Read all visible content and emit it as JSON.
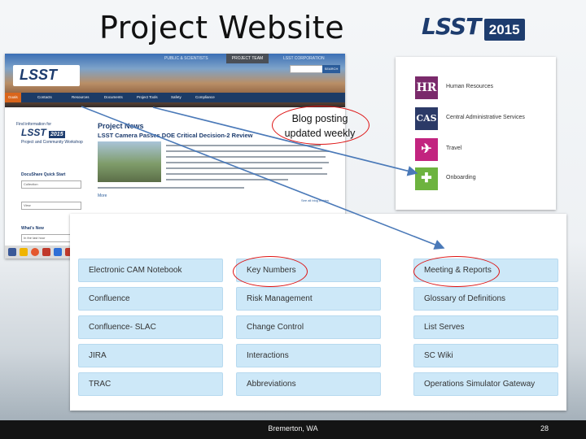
{
  "slide": {
    "title": "Project Website",
    "logo_text": "LSST",
    "logo_year": "2015",
    "footer_location": "Bremerton, WA",
    "page_number": "28",
    "callout": {
      "line1": "Blog posting",
      "line2": "updated weekly"
    }
  },
  "website": {
    "top_links": [
      "PUBLIC & SCIENTISTS",
      "PROJECT TEAM",
      "LSST CORPORATION"
    ],
    "search_button": "SEARCH",
    "logo": "LSST",
    "nav": [
      "Goals",
      "Contacts",
      "Resources",
      "Documents",
      "Project Tools",
      "Safety",
      "Compliance"
    ],
    "side": {
      "find_info": "Find information for",
      "logo": "LSST",
      "logo_year": "2015",
      "workshop": "Project and Community Workshop",
      "docushare": "DocuShare Quick Start",
      "collection_value": "Collection",
      "view_value": "View",
      "whats_new": "What's New",
      "whats_new_value": "In the last hour"
    },
    "main": {
      "heading": "Project News",
      "headline": "LSST Camera Passes DOE Critical Decision-2 Review",
      "more": "More",
      "blog_link": "See all blog entries"
    }
  },
  "hr_panel": {
    "items": [
      {
        "icon": "HR",
        "label": "Human Resources",
        "color": "#7a2a6b"
      },
      {
        "icon": "CAS",
        "label": "Central Administrative Services",
        "color": "#2b3a67"
      },
      {
        "icon": "plane-icon",
        "label": "Travel",
        "color": "#c2247f"
      },
      {
        "icon": "puzzle-icon",
        "label": "Onboarding",
        "color": "#6db33f"
      }
    ]
  },
  "confluence_panel": {
    "columns": [
      [
        "Electronic CAM Notebook",
        "Confluence",
        "Confluence- SLAC",
        "JIRA",
        "TRAC"
      ],
      [
        "Key Numbers",
        "Risk Management",
        "Change Control",
        "Interactions",
        "Abbreviations"
      ],
      [
        "Meeting & Reports",
        "Glossary of Definitions",
        "List Serves",
        "SC Wiki",
        "Operations Simulator Gateway"
      ]
    ]
  },
  "colors": {
    "accent": "#1d3c6e",
    "tile": "#cde8f8",
    "annotation": "#dd1111",
    "arrow": "#4a79b8"
  }
}
